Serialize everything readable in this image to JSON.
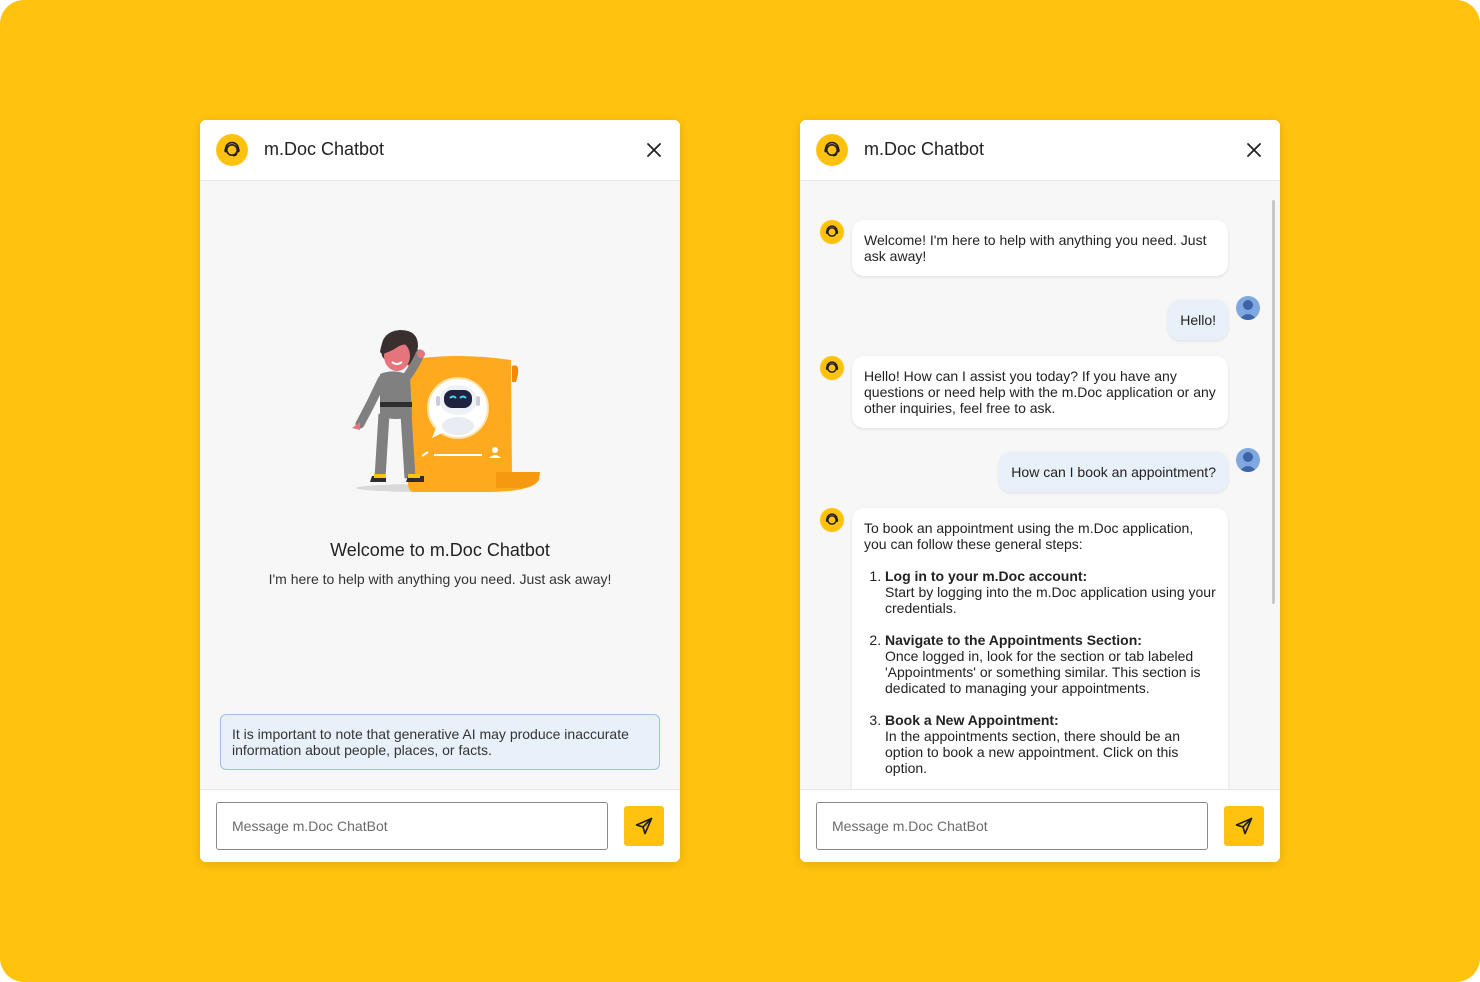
{
  "colors": {
    "background": "#FFC20E",
    "accent": "#FFC20E",
    "disclaimer_bg": "#E8F0FA",
    "disclaimer_border": "#9EC0E8",
    "user_bubble": "#E8F0FA"
  },
  "icons": {
    "bot": "headset-bot-icon",
    "close": "close-icon",
    "send": "send-icon",
    "user": "user-avatar-icon"
  },
  "left_panel": {
    "title": "m.Doc Chatbot",
    "welcome_title": "Welcome to m.Doc Chatbot",
    "welcome_subtitle": "I'm here to help with anything you need. Just ask away!",
    "disclaimer": "It is important to note that generative AI may produce inaccurate information about people, places, or facts.",
    "input_placeholder": "Message m.Doc ChatBot"
  },
  "right_panel": {
    "title": "m.Doc Chatbot",
    "input_placeholder": "Message m.Doc ChatBot",
    "messages": [
      {
        "role": "bot",
        "text": "Welcome! I'm here to help with anything you need. Just ask away!"
      },
      {
        "role": "user",
        "text": "Hello!"
      },
      {
        "role": "bot",
        "text": "Hello! How can I assist you today? If you have any questions or need help with the m.Doc application or any other inquiries, feel free to ask."
      },
      {
        "role": "user",
        "text": "How can I book an appointment?"
      },
      {
        "role": "bot",
        "intro": "To book an appointment using the m.Doc application, you can follow these general steps:",
        "steps": [
          {
            "title": "Log in to your m.Doc account:",
            "body": "Start by logging into the m.Doc application using your credentials."
          },
          {
            "title": "Navigate to the Appointments Section:",
            "body": "Once logged in, look for the section or tab labeled 'Appointments' or something similar. This section is dedicated to managing your appointments."
          },
          {
            "title": "Book a New Appointment:",
            "body": "In the appointments section, there should be an option to book a new appointment. Click on this option."
          }
        ]
      }
    ]
  }
}
